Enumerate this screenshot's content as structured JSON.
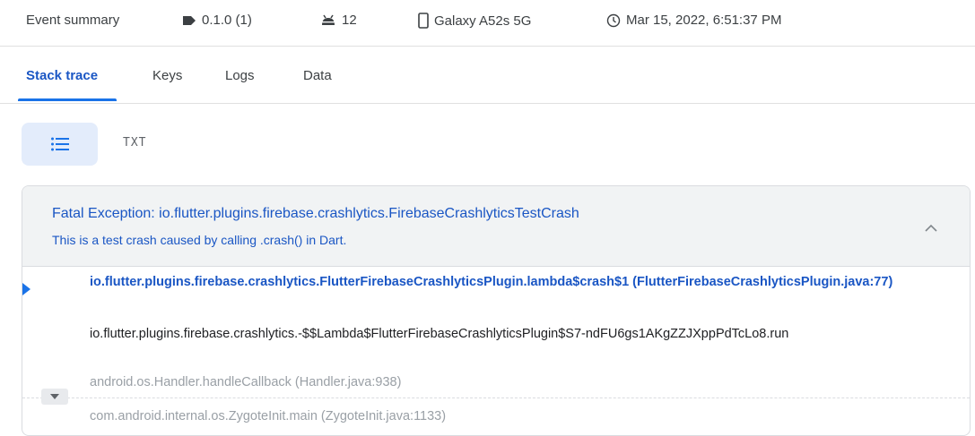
{
  "summary": {
    "title": "Event summary",
    "version": "0.1.0 (1)",
    "android_version": "12",
    "device": "Galaxy A52s 5G",
    "timestamp": "Mar 15, 2022, 6:51:37 PM"
  },
  "tabs": [
    {
      "label": "Stack trace",
      "active": true
    },
    {
      "label": "Keys",
      "active": false
    },
    {
      "label": "Logs",
      "active": false
    },
    {
      "label": "Data",
      "active": false
    }
  ],
  "view_toggle": {
    "list_icon": "list-icon",
    "txt_label": "TXT"
  },
  "exception": {
    "title": "Fatal Exception: io.flutter.plugins.firebase.crashlytics.FirebaseCrashlyticsTestCrash",
    "message": "This is a test crash caused by calling .crash() in Dart."
  },
  "frames": [
    {
      "text": "io.flutter.plugins.firebase.crashlytics.FlutterFirebaseCrashlyticsPlugin.lambda$crash$1 (FlutterFirebaseCrashlyticsPlugin.java:77)",
      "style": "highlighted"
    },
    {
      "text": "io.flutter.plugins.firebase.crashlytics.-$$Lambda$FlutterFirebaseCrashlyticsPlugin$S7-ndFU6gs1AKgZZJXppPdTcLo8.run",
      "style": "normal"
    },
    {
      "text": "android.os.Handler.handleCallback (Handler.java:938)",
      "style": "dimmed"
    },
    {
      "text": "com.android.internal.os.ZygoteInit.main (ZygoteInit.java:1133)",
      "style": "dimmed"
    }
  ],
  "colors": {
    "accent": "#1a73e8",
    "link_text": "#1a56c4",
    "toggle_bg": "#e3ecfb",
    "header_bg": "#f1f3f4"
  }
}
